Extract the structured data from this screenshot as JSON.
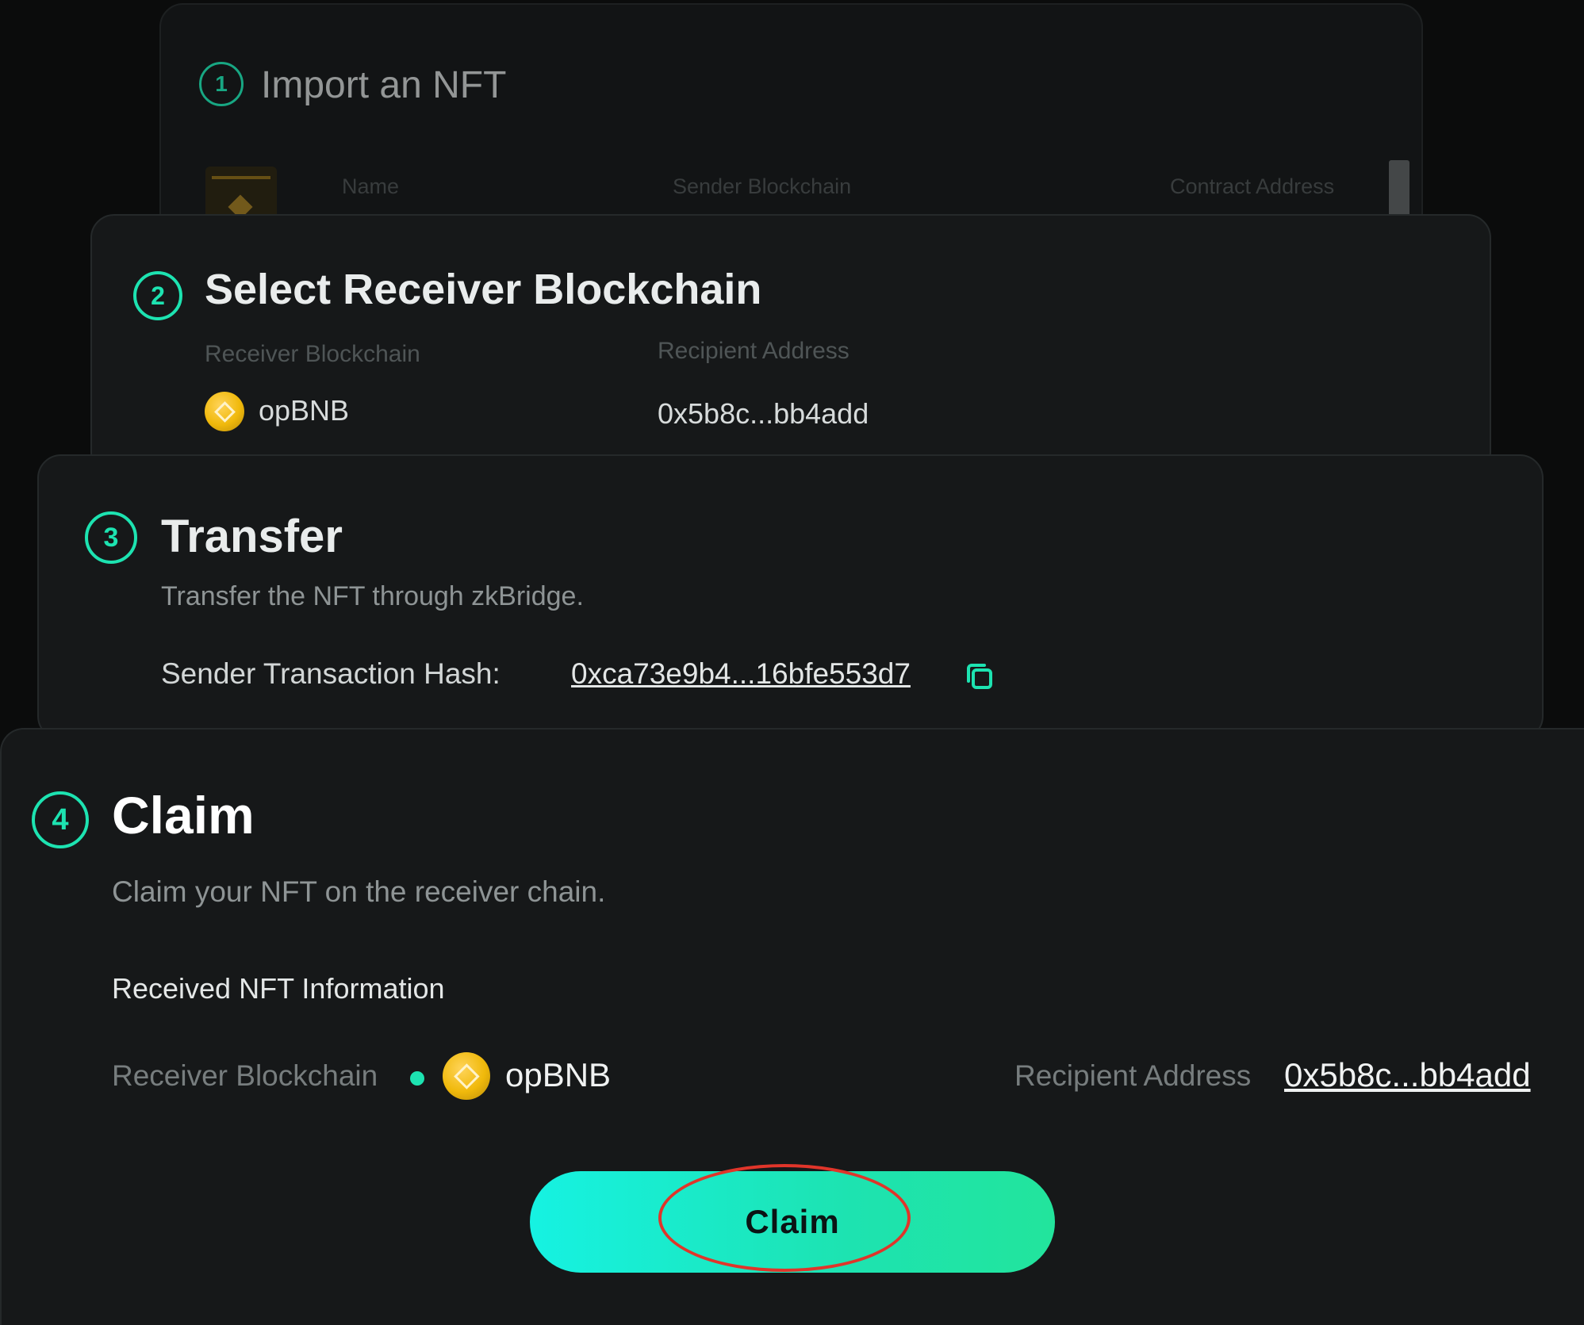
{
  "step1": {
    "number": "1",
    "title": "Import an NFT",
    "columns": [
      "Name",
      "Sender Blockchain",
      "Contract Address"
    ]
  },
  "step2": {
    "number": "2",
    "title": "Select Receiver Blockchain",
    "receiver_label": "Receiver Blockchain",
    "recipient_label": "Recipient Address",
    "receiver_value": "opBNB",
    "recipient_value": "0x5b8c...bb4add"
  },
  "step3": {
    "number": "3",
    "title": "Transfer",
    "subtitle": "Transfer the NFT through zkBridge.",
    "hash_label": "Sender Transaction Hash:",
    "hash_value": "0xca73e9b4...16bfe553d7"
  },
  "step4": {
    "number": "4",
    "title": "Claim",
    "subtitle": "Claim your NFT on the receiver chain.",
    "section_title": "Received NFT Information",
    "receiver_label": "Receiver Blockchain",
    "receiver_value": "opBNB",
    "recipient_label": "Recipient Address",
    "recipient_value": "0x5b8c...bb4add",
    "button_label": "Claim"
  },
  "icons": {
    "chain_icon": "bnb-coin-icon",
    "copy": "copy-icon",
    "status": "status-dot"
  },
  "colors": {
    "accent": "#1de3b1",
    "button_gradient_start": "#16f2e2",
    "button_gradient_end": "#22e49c",
    "highlight": "#e0352a",
    "card_bg": "#161819",
    "page_bg": "#0b0c0c"
  }
}
